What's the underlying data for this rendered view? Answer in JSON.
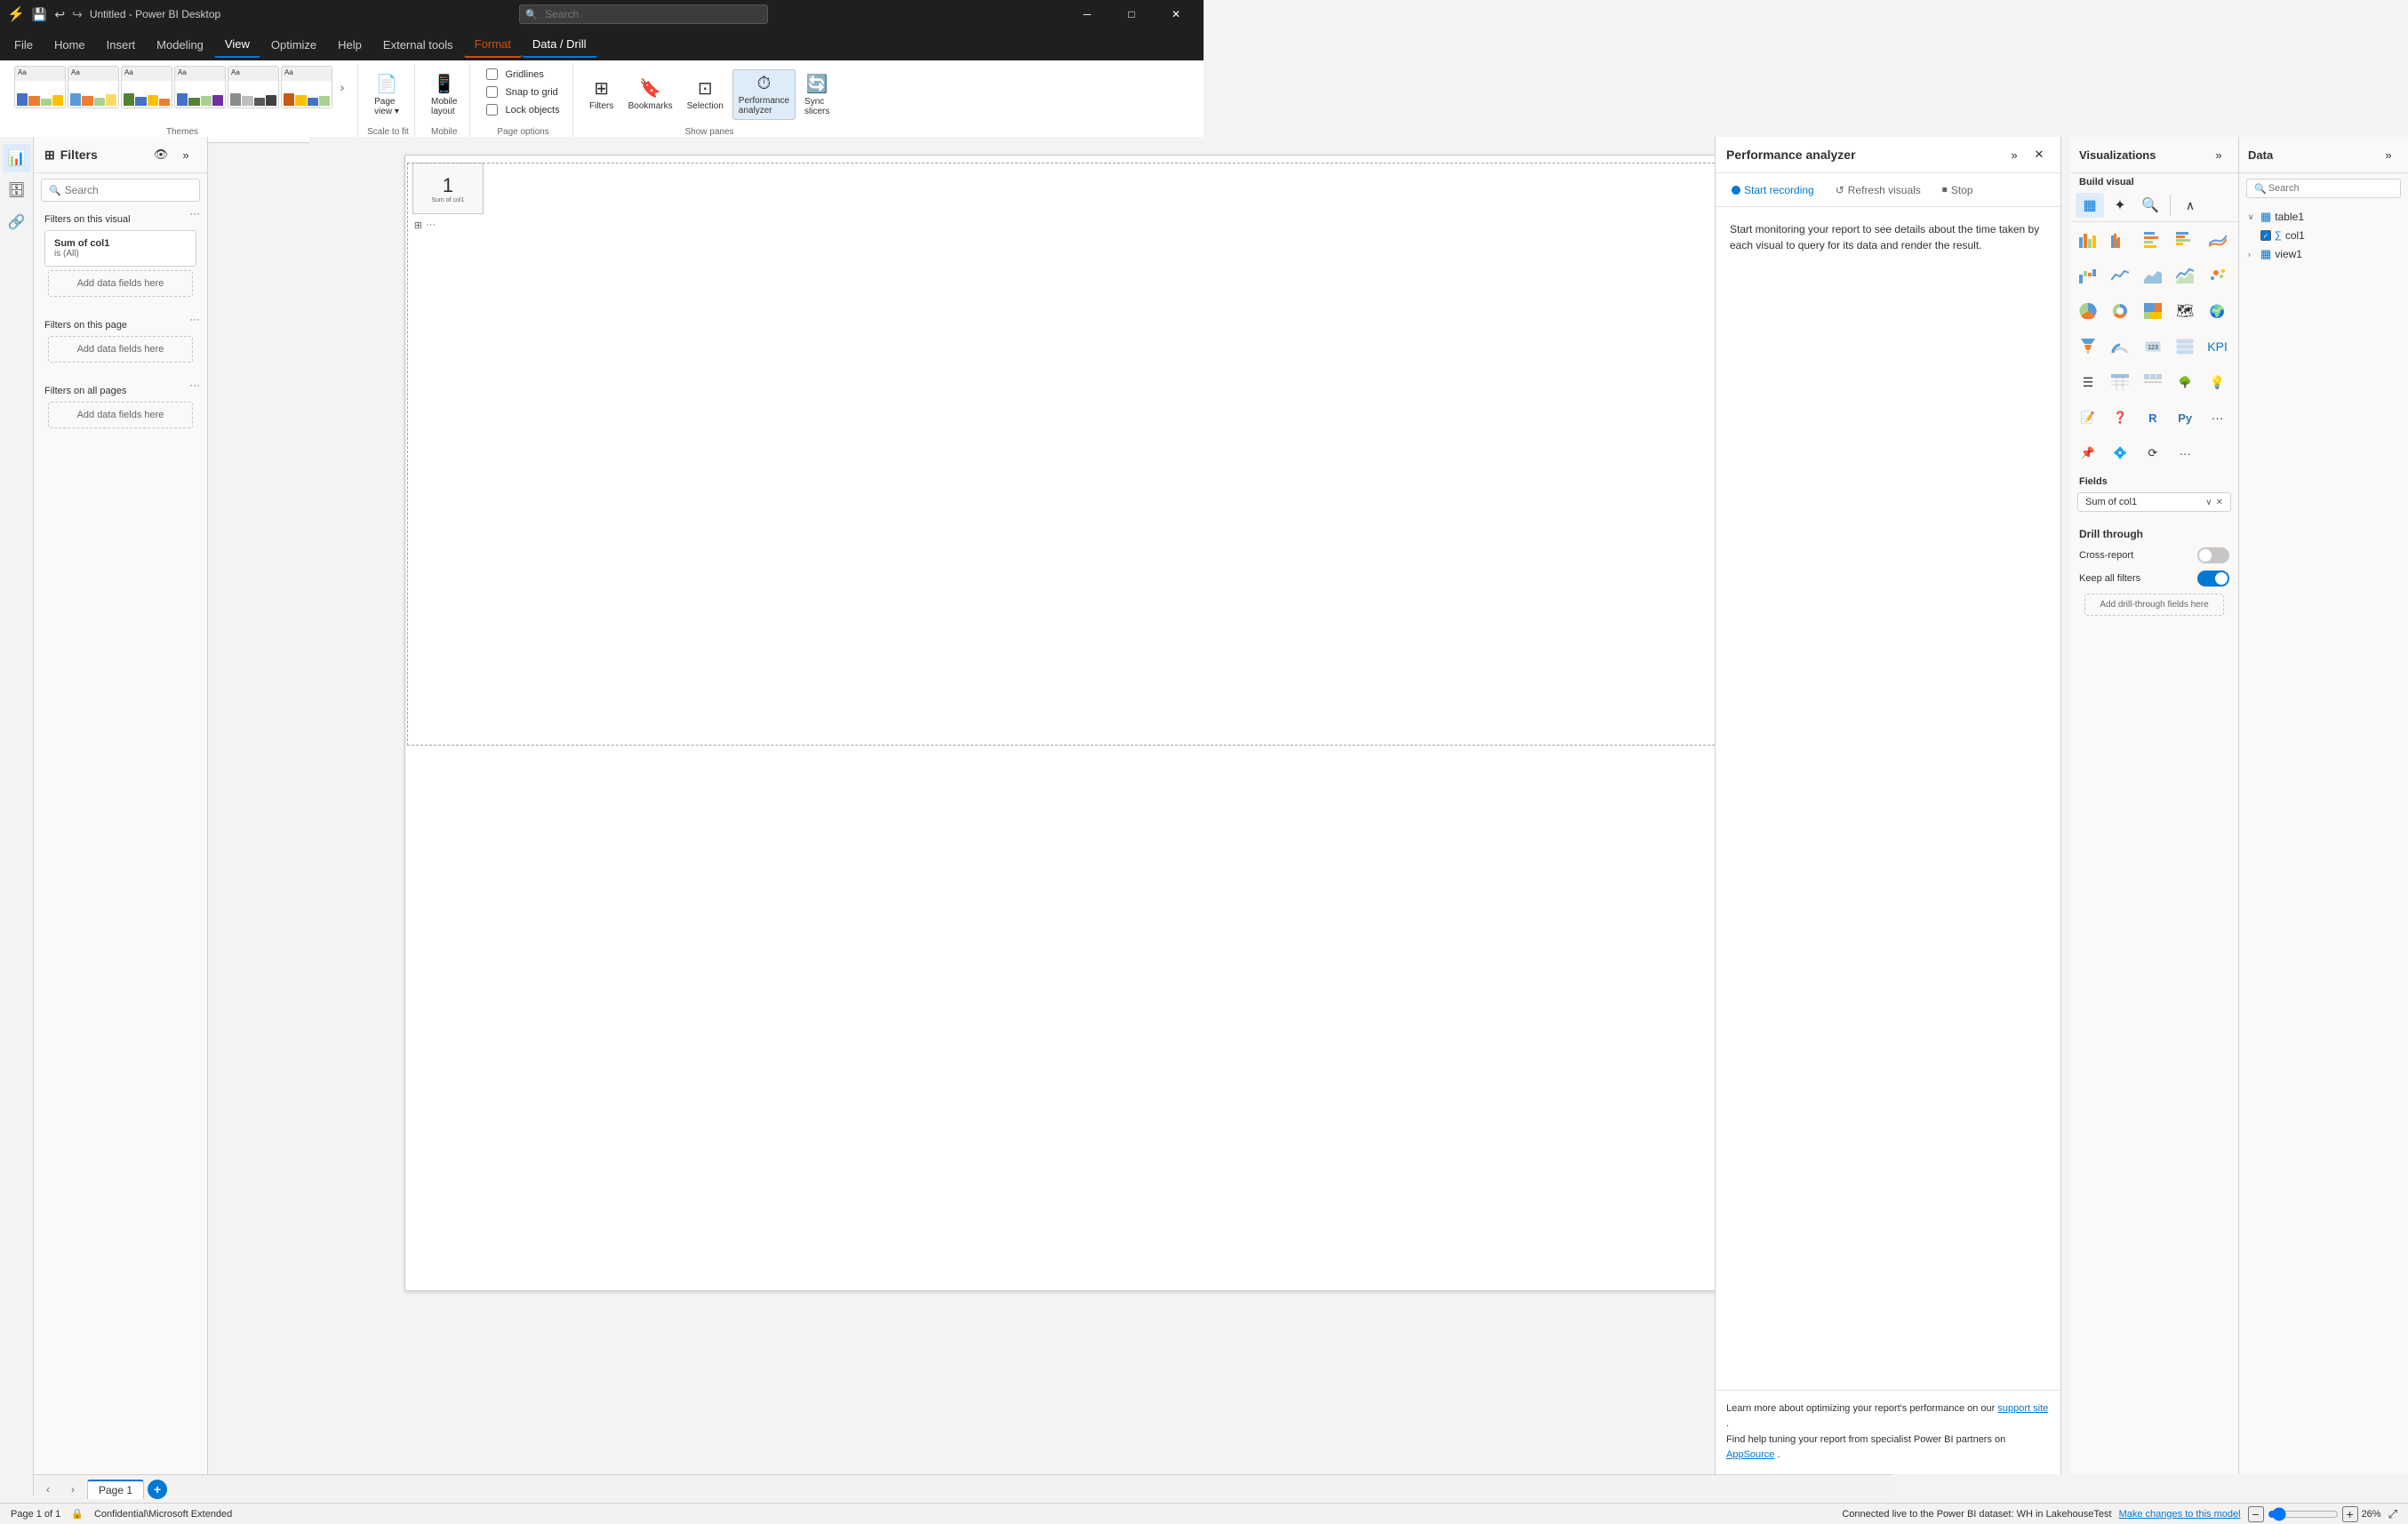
{
  "titleBar": {
    "title": "Untitled - Power BI Desktop",
    "searchPlaceholder": "Search",
    "buttons": [
      "minimize",
      "maximize",
      "close"
    ]
  },
  "menuBar": {
    "items": [
      "File",
      "Home",
      "Insert",
      "Modeling",
      "View",
      "Optimize",
      "Help",
      "External tools",
      "Format",
      "Data / Drill"
    ]
  },
  "ribbon": {
    "themes": {
      "label": "Themes",
      "items": [
        "theme1",
        "theme2",
        "theme3",
        "theme4",
        "theme5",
        "theme6"
      ]
    },
    "scaleToFit": {
      "label": "Scale to fit",
      "group": "Page view"
    },
    "mobile": {
      "label": "Mobile layout",
      "group": "Mobile"
    },
    "pageOptions": {
      "items": [
        "Gridlines",
        "Snap to grid",
        "Lock objects"
      ],
      "label": "Page options"
    },
    "showPanes": {
      "items": [
        "Filters",
        "Bookmarks",
        "Selection",
        "Performance analyzer",
        "Sync slicers"
      ],
      "label": "Show panes"
    }
  },
  "filterPanel": {
    "title": "Filters",
    "searchPlaceholder": "Search",
    "sections": [
      {
        "title": "Filters on this visual",
        "filters": [
          {
            "name": "Sum of col1",
            "condition": "is (All)"
          }
        ],
        "addLabel": "Add data fields here"
      },
      {
        "title": "Filters on this page",
        "filters": [],
        "addLabel": "Add data fields here"
      },
      {
        "title": "Filters on all pages",
        "filters": [],
        "addLabel": "Add data fields here"
      }
    ]
  },
  "perfAnalyzer": {
    "title": "Performance analyzer",
    "startRecording": "Start recording",
    "refreshVisuals": "Refresh visuals",
    "stop": "Stop",
    "description": "Start monitoring your report to see details about the time taken by each visual to query for its data and render the result.",
    "footer1": "Learn more about optimizing your report's performance on our",
    "footerLink1": "support site",
    "footer2": "Find help tuning your report from specialist Power BI partners on",
    "footerLink2": "AppSource",
    "footerDot": "."
  },
  "visualizations": {
    "title": "Visualizations",
    "buildVisualLabel": "Build visual",
    "icons": [
      "stacked-bar",
      "clustered-bar",
      "stacked-bar-h",
      "clustered-bar-h",
      "ribbon-chart",
      "waterfall",
      "line",
      "area",
      "line-area",
      "scatter",
      "pie",
      "donut",
      "treemap",
      "map",
      "filled-map",
      "funnel",
      "gauge",
      "card",
      "multi-row-card",
      "kpi",
      "slicer",
      "table",
      "matrix",
      "decomp",
      "key-influencer",
      "smart-narrative",
      "q-a",
      "r-visual",
      "py-visual",
      "more"
    ],
    "fieldsLabel": "Fields",
    "fieldValue": "Sum of col1",
    "drillThrough": {
      "label": "Drill through",
      "crossReport": "Cross-report",
      "keepAllFilters": "Keep all filters",
      "crossReportValue": "Off",
      "keepAllFiltersValue": "On",
      "addFieldsLabel": "Add drill-through fields here"
    }
  },
  "dataPanel": {
    "title": "Data",
    "searchPlaceholder": "Search",
    "tree": [
      {
        "name": "table1",
        "expanded": true,
        "children": [
          {
            "name": "col1",
            "checked": true,
            "type": "measure"
          }
        ]
      },
      {
        "name": "view1",
        "expanded": false,
        "children": []
      }
    ]
  },
  "pageNav": {
    "currentPage": "Page 1",
    "total": "Page 1 of 1"
  },
  "statusBar": {
    "left": "Page 1 of 1",
    "confidential": "Confidential\\Microsoft Extended",
    "connection": "Connected live to the Power BI dataset: WH in LakehouseTest",
    "makeChanges": "Make changes to this model",
    "zoom": "26%"
  }
}
